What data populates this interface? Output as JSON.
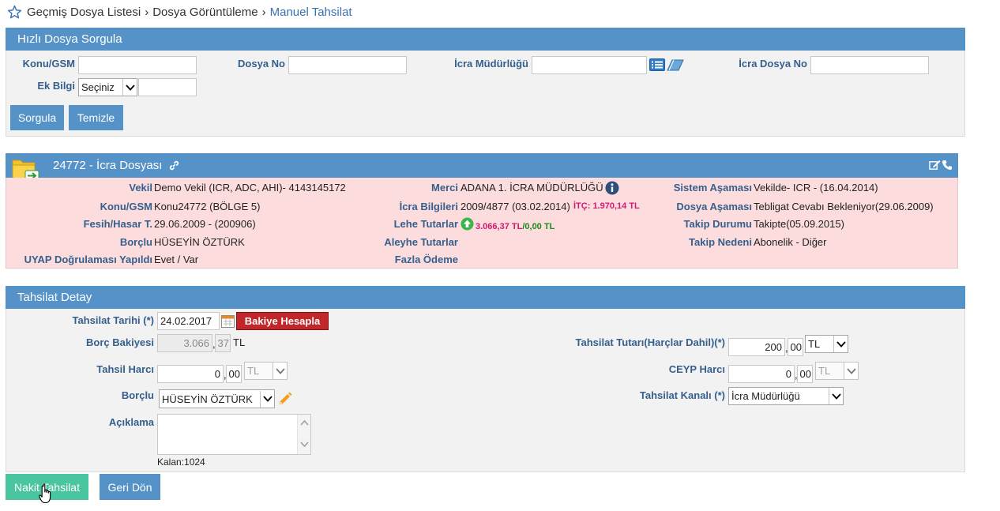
{
  "breadcrumb": {
    "items": [
      "Geçmiş Dosya Listesi",
      "Dosya Görüntüleme"
    ],
    "separator": "›",
    "current": "Manuel Tahsilat"
  },
  "quick_search": {
    "title": "Hızlı Dosya Sorgula",
    "konu_label": "Konu/GSM",
    "dosya_no_label": "Dosya No",
    "icra_mudurlugu_label": "İcra Müdürlüğü",
    "icra_dosya_no_label": "İcra Dosya No",
    "ek_bilgi_label": "Ek Bilgi",
    "ek_bilgi_selected": "Seçiniz",
    "konu_value": "",
    "dosya_no_value": "",
    "icra_mudurlugu_value": "",
    "icra_dosya_no_value": "",
    "ek_bilgi_value": "",
    "search_button": "Sorgula",
    "clear_button": "Temizle"
  },
  "file": {
    "title": "24772 - İcra Dosyası",
    "vekil_label": "Vekil",
    "vekil_value": "Demo Vekil  (ICR, ADC, AHI)- 4143145172",
    "konu_label": "Konu/GSM",
    "konu_value": "Konu24772 (BÖLGE 5)",
    "fesih_label": "Fesih/Hasar T.",
    "fesih_value": "29.06.2009 - (200906)",
    "borclu_label": "Borçlu",
    "borclu_value": "HÜSEYİN ÖZTÜRK",
    "uyap_label": "UYAP Doğrulaması Yapıldı",
    "uyap_value": "Evet / Var",
    "merci_label": "Merci",
    "merci_value": "ADANA 1. İCRA MÜDÜRLÜĞÜ",
    "icra_bilgileri_label": "İcra Bilgileri",
    "icra_bilgileri_value": "2009/4877 (03.02.2014)",
    "itc_value": "İTÇ: 1.970,14 TL",
    "lehe_label": "Lehe Tutarlar",
    "lehe_value_1": "3.066,37 TL",
    "lehe_sep": "/",
    "lehe_value_2": "0,00 TL",
    "aleyhe_label": "Aleyhe Tutarlar",
    "fazla_label": "Fazla Ödeme",
    "sistem_label": "Sistem Aşaması",
    "sistem_value": "Vekilde- ICR - (16.04.2014)",
    "dosya_asamasi_label": "Dosya Aşaması",
    "dosya_asamasi_value": "Tebligat Cevabı Bekleniyor(29.06.2009)",
    "takip_durumu_label": "Takip Durumu",
    "takip_durumu_value": "Takipte(05.09.2015)",
    "takip_nedeni_label": "Takip Nedeni",
    "takip_nedeni_value": "Abonelik - Diğer"
  },
  "detail": {
    "title": "Tahsilat Detay",
    "tarih_label": "Tahsilat Tarihi (*)",
    "tarih_value": "24.02.2017",
    "bakiye_button": "Bakiye Hesapla",
    "borc_label": "Borç Bakiyesi",
    "borc_int": "3.066",
    "borc_comma": ",",
    "borc_dec": "37",
    "borc_currency": "TL",
    "harc_label": "Tahsil Harcı",
    "harc_int": "0",
    "harc_comma": ",",
    "harc_dec": "00",
    "harc_currency": "TL",
    "borclu_label": "Borçlu",
    "borclu_selected": "HÜSEYİN ÖZTÜRK",
    "aciklama_label": "Açıklama",
    "aciklama_value": "",
    "kalan": "Kalan:1024",
    "tutar_label": "Tahsilat Tutarı(Harçlar Dahil)(*)",
    "tutar_int": "200",
    "tutar_comma": ",",
    "tutar_dec": "00",
    "tutar_currency": "TL",
    "ceyp_label": "CEYP Harcı",
    "ceyp_int": "0",
    "ceyp_comma": ",",
    "ceyp_dec": "00",
    "ceyp_currency": "TL",
    "kanal_label": "Tahsilat Kanalı (*)",
    "kanal_selected": "İcra Müdürlüğü"
  },
  "actions": {
    "nakit_button": "Nakit Tahsilat",
    "geri_button": "Geri Dön"
  },
  "colors": {
    "header_blue": "#5592c8",
    "label_blue": "#355f8c",
    "file_bg_pink": "#fcdcdc",
    "success_green": "#4ac5a0",
    "danger_red": "#c0262a",
    "itc_magenta": "#d11a72"
  }
}
